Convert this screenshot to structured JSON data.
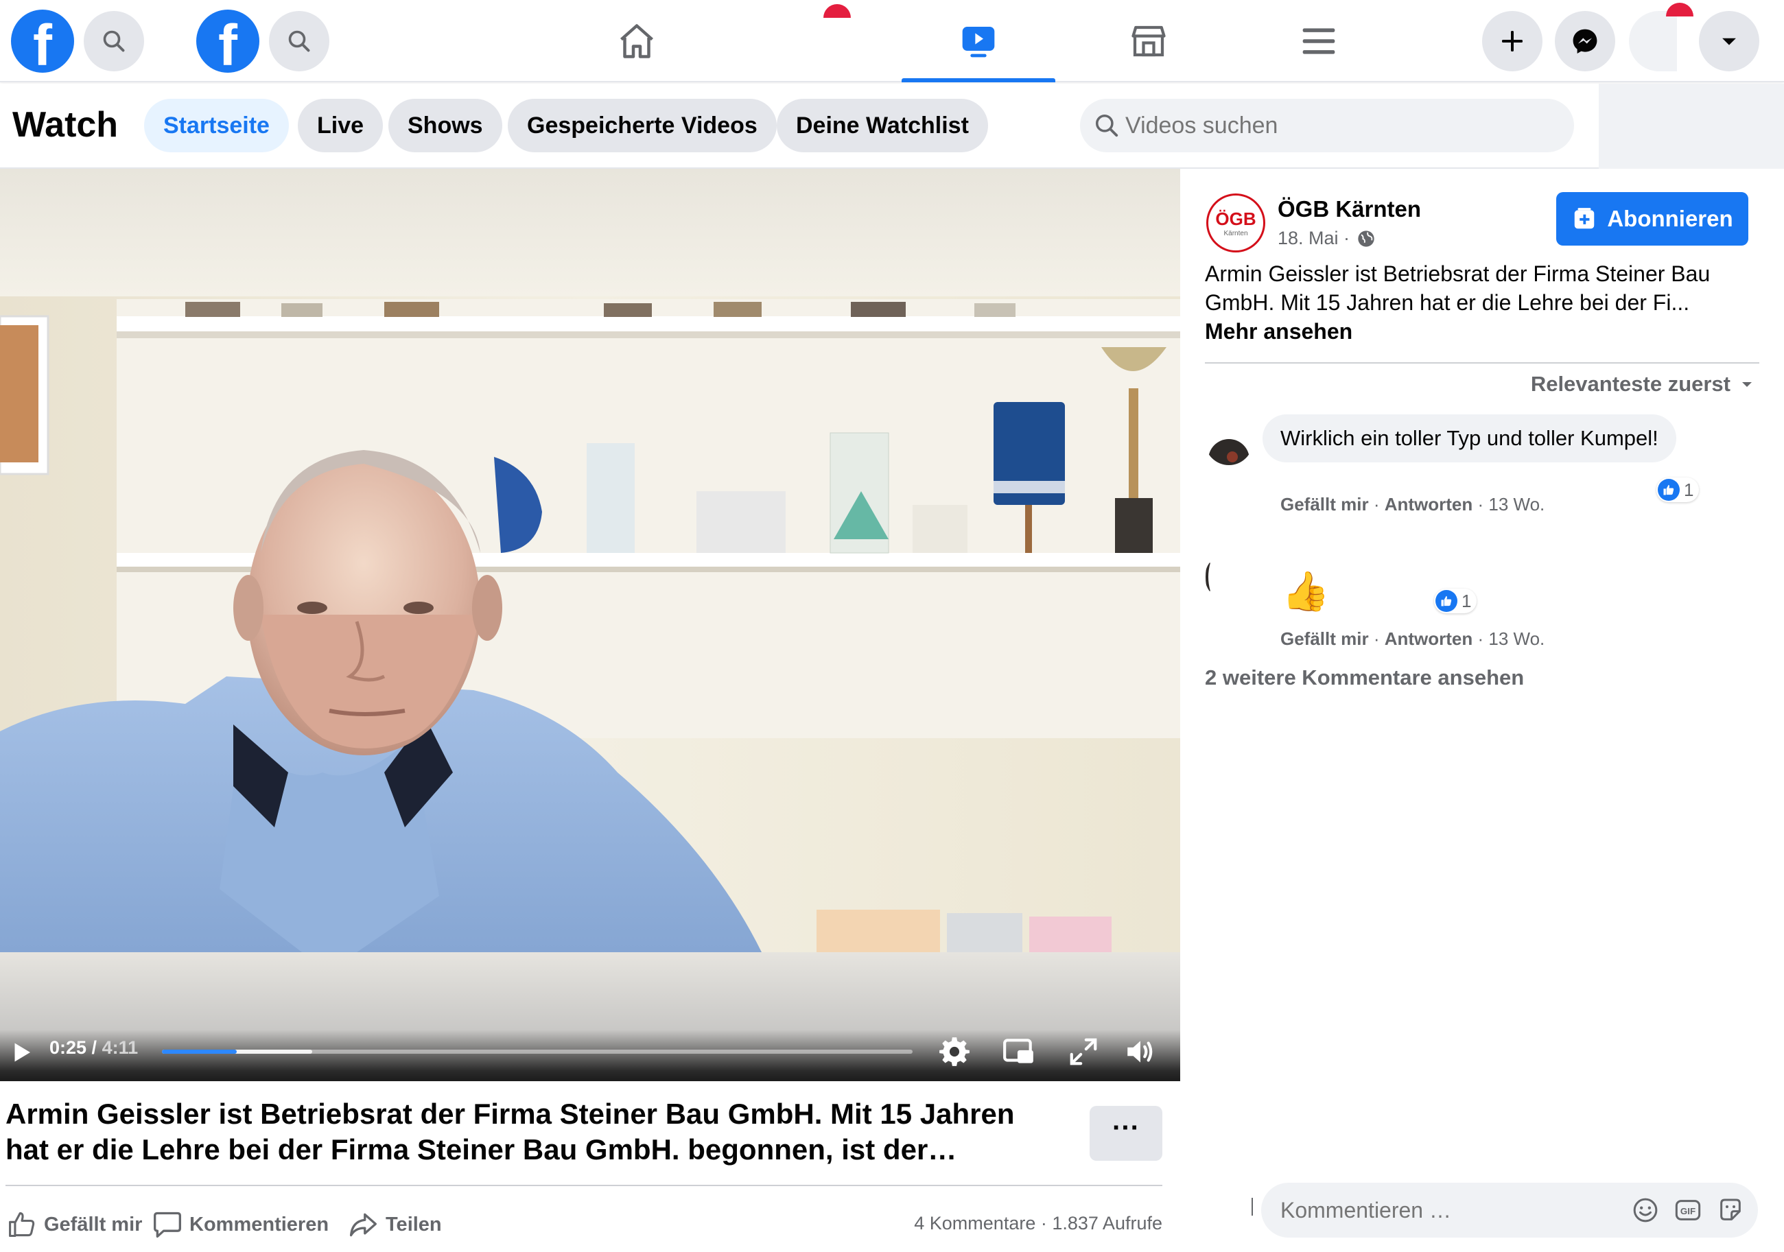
{
  "nav": {
    "tabs": [
      "home",
      "watch",
      "marketplace",
      "menu"
    ],
    "active_tab": "watch"
  },
  "watch": {
    "title": "Watch",
    "chips": [
      "Startseite",
      "Live",
      "Shows",
      "Gespeicherte Videos",
      "Deine Watchlist"
    ],
    "active_chip": "Startseite",
    "search_placeholder": "Videos suchen"
  },
  "video": {
    "current_time": "0:25",
    "duration": "4:11",
    "time_separator": " / ",
    "progress_fraction": 0.1,
    "buffered_fraction": 0.2,
    "title": "Armin Geissler ist Betriebsrat der Firma Steiner Bau GmbH. Mit 15 Jahren hat er die Lehre bei der Firma Steiner Bau GmbH. begonnen, ist der…",
    "more_label": "···",
    "actions": {
      "like": "Gefällt mir",
      "comment": "Kommentieren",
      "share": "Teilen"
    },
    "stats": {
      "comments": "4 Kommentare",
      "separator": " · ",
      "views": "1.837 Aufrufe"
    }
  },
  "post": {
    "page_name": "ÖGB Kärnten",
    "avatar_text": "ÖGB",
    "avatar_subtext": "Kärnten",
    "date": "18. Mai ·",
    "subscribe_label": "Abonnieren",
    "text": "Armin Geissler ist Betriebsrat der Firma Steiner Bau GmbH. Mit 15 Jahren hat er die Lehre bei der Fi...",
    "see_more": "Mehr ansehen"
  },
  "comments": {
    "sort_label": "Relevanteste zuerst",
    "items": [
      {
        "text": "Wirklich ein toller Typ und toller Kumpel!",
        "like": "Gefällt mir",
        "reply": "Antworten",
        "age": "13 Wo.",
        "reactions": "1"
      },
      {
        "text": "👍",
        "like": "Gefällt mir",
        "reply": "Antworten",
        "age": "13 Wo.",
        "reactions": "1"
      }
    ],
    "more_label": "2 weitere Kommentare ansehen",
    "input_placeholder": "Kommentieren …"
  },
  "colors": {
    "brand_blue": "#1877f2",
    "ogb_red": "#d40f1a",
    "badge_red": "#e41e3f"
  }
}
